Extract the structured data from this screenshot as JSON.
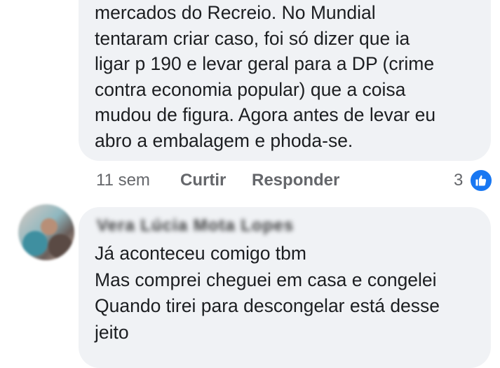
{
  "comment_1": {
    "text": "mercados do Recreio. No Mundial\ntentaram criar caso, foi só dizer que ia\nligar p 190 e levar geral para a DP (crime\ncontra economia popular) que a coisa\nmudou de figura. Agora antes de levar eu\nabro a embalagem e phoda-se.",
    "timestamp": "11 sem",
    "like_label": "Curtir",
    "reply_label": "Responder",
    "reaction_count": "3",
    "reaction_icon": "like-thumbs-up-icon",
    "reaction_color": "#1877f2"
  },
  "comment_2": {
    "author": "Vera Lúcia Mota Lopes",
    "text": "Já aconteceu comigo tbm\nMas comprei cheguei em casa e congelei\nQuando tirei para descongelar está desse\njeito"
  },
  "colors": {
    "bubble": "#f0f2f5",
    "text": "#1c1e21",
    "secondary_text": "#65676b"
  }
}
